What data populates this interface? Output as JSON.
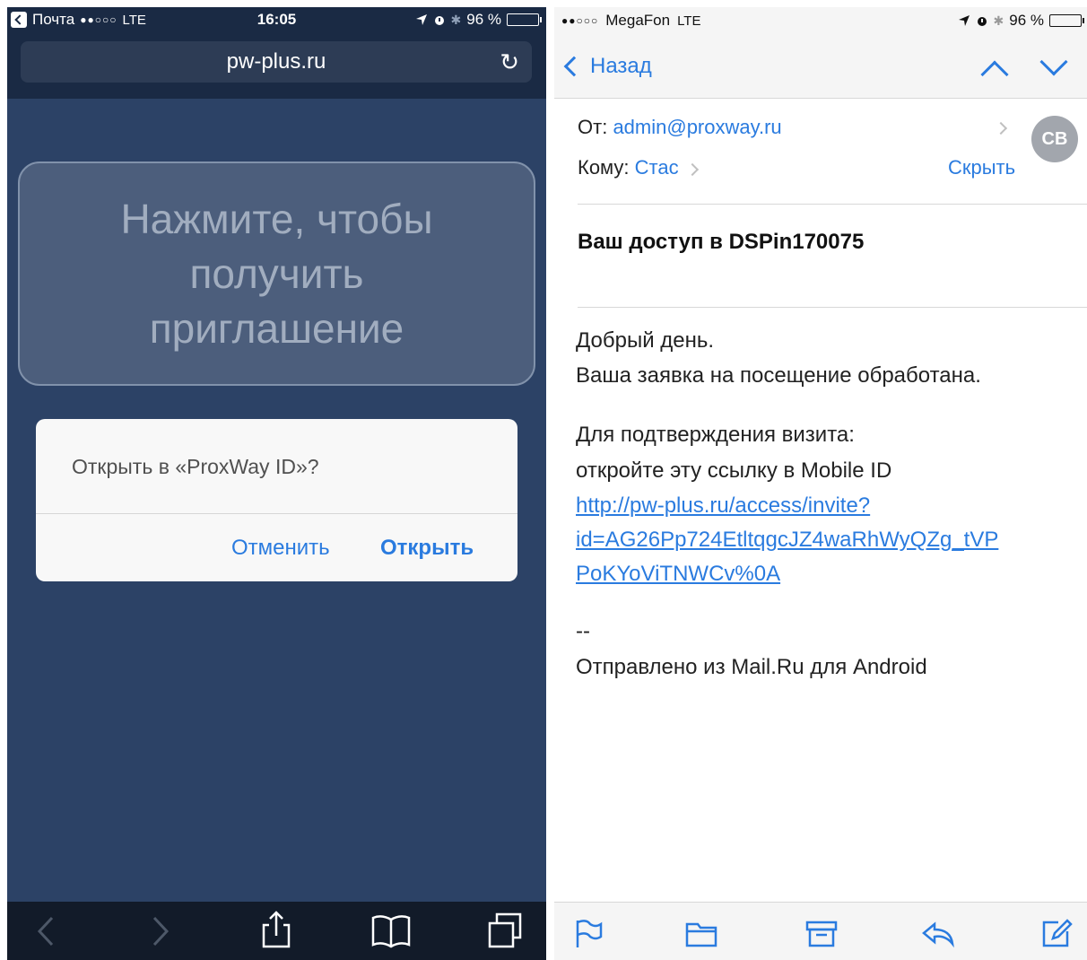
{
  "left_panel": {
    "status_bar": {
      "back_app": "Почта",
      "signal": "●●○○○",
      "network": "LTE",
      "time": "16:05",
      "battery": "96 %",
      "battery_level": 0.96
    },
    "url_bar": {
      "url": "pw-plus.ru",
      "reload_icon": "reload-icon"
    },
    "page": {
      "invite_text": "Нажмите, чтобы получить приглашение"
    },
    "alert": {
      "message": "Открыть в «ProxWay ID»?",
      "cancel_label": "Отменить",
      "open_label": "Открыть"
    },
    "toolbar": {
      "icons": [
        "back-icon",
        "forward-icon",
        "share-icon",
        "bookmarks-icon",
        "tabs-icon"
      ]
    }
  },
  "right_panel": {
    "status_bar": {
      "signal": "●●○○○",
      "carrier": "MegaFon",
      "network": "LTE",
      "battery": "96 %",
      "battery_level": 0.96
    },
    "nav": {
      "back_label": "Назад"
    },
    "header": {
      "from_label": "От:",
      "from_value": "admin@proxway.ru",
      "to_label": "Кому:",
      "to_value": "Стас",
      "hide_label": "Скрыть",
      "avatar_initials": "CB"
    },
    "subject": "Ваш доступ в DSPin170075",
    "body": {
      "greeting": "Добрый день.",
      "line2": "Ваша заявка на посещение обработана.",
      "line3": "Для подтверждения визита:",
      "line4": "откройте эту ссылку в Mobile ID",
      "link_line1": "http://pw-plus.ru/access/invite?",
      "link_line2": "id=AG26Pp724EtltqgcJZ4waRhWyQZg_tVP",
      "link_line3": "PoKYoViTNWCv%0A",
      "sig_sep": "--",
      "signature": "Отправлено из Mail.Ru для Android"
    },
    "toolbar": {
      "icons": [
        "flag-icon",
        "folder-icon",
        "archive-icon",
        "reply-icon",
        "compose-icon"
      ]
    }
  },
  "colors": {
    "ios_blue": "#2a7bdf",
    "page_bg": "#2c4266",
    "safari_bar": "#1a2a44"
  }
}
